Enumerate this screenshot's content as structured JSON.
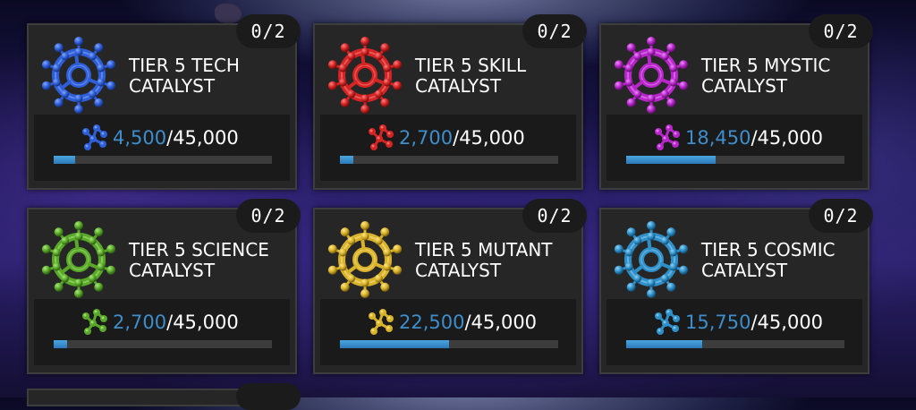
{
  "cards": [
    {
      "title1": "TIER 5 TECH",
      "title2": "CATALYST",
      "badge": "0/2",
      "current": "4,500",
      "total": "/45,000",
      "progress": 0.1,
      "color": "#2f5fd8",
      "colorLight": "#7fa6ff",
      "colorDark": "#142f7a",
      "icon": "tech-catalyst-icon"
    },
    {
      "title1": "TIER 5 SKILL",
      "title2": "CATALYST",
      "badge": "0/2",
      "current": "2,700",
      "total": "/45,000",
      "progress": 0.06,
      "color": "#d42424",
      "colorLight": "#ff7f7f",
      "colorDark": "#6e0c0c",
      "icon": "skill-catalyst-icon"
    },
    {
      "title1": "TIER 5 MYSTIC",
      "title2": "CATALYST",
      "badge": "0/2",
      "current": "18,450",
      "total": "/45,000",
      "progress": 0.41,
      "color": "#b626c8",
      "colorLight": "#ee8cff",
      "colorDark": "#5b0d66",
      "icon": "mystic-catalyst-icon"
    },
    {
      "title1": "TIER 5 SCIENCE",
      "title2": "CATALYST",
      "badge": "0/2",
      "current": "2,700",
      "total": "/45,000",
      "progress": 0.06,
      "color": "#5aa82a",
      "colorLight": "#a8ea7a",
      "colorDark": "#2b5a10",
      "icon": "science-catalyst-icon"
    },
    {
      "title1": "TIER 5 MUTANT",
      "title2": "CATALYST",
      "badge": "0/2",
      "current": "22,500",
      "total": "/45,000",
      "progress": 0.5,
      "color": "#d8b22a",
      "colorLight": "#ffe68a",
      "colorDark": "#7a5e0c",
      "icon": "mutant-catalyst-icon"
    },
    {
      "title1": "TIER 5 COSMIC",
      "title2": "CATALYST",
      "badge": "0/2",
      "current": "15,750",
      "total": "/45,000",
      "progress": 0.35,
      "color": "#2f8fc8",
      "colorLight": "#8fd2f5",
      "colorDark": "#0f4b70",
      "icon": "cosmic-catalyst-icon"
    }
  ]
}
